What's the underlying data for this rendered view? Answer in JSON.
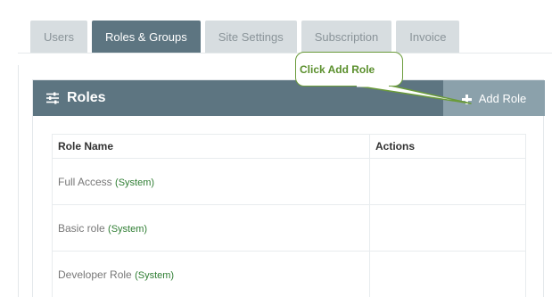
{
  "tabs": [
    {
      "label": "Users",
      "active": false
    },
    {
      "label": "Roles & Groups",
      "active": true
    },
    {
      "label": "Site Settings",
      "active": false
    },
    {
      "label": "Subscription",
      "active": false
    },
    {
      "label": "Invoice",
      "active": false
    }
  ],
  "panel": {
    "title": "Roles",
    "title_icon": "sliders-icon",
    "add_button": {
      "label": "Add Role",
      "icon": "plus-icon"
    }
  },
  "table": {
    "columns": [
      "Role Name",
      "Actions"
    ],
    "rows": [
      {
        "name": "Full Access",
        "tag": "(System)",
        "actions": ""
      },
      {
        "name": "Basic role",
        "tag": "(System)",
        "actions": ""
      },
      {
        "name": "Developer Role",
        "tag": "(System)",
        "actions": ""
      }
    ]
  },
  "callout": {
    "text": "Click Add Role"
  },
  "colors": {
    "header_bg": "#5d7581",
    "add_button_bg": "#8ba1ab",
    "tab_inactive_bg": "#d7dde0",
    "system_tag": "#2e7d32",
    "callout_border": "#6a9b3a"
  }
}
